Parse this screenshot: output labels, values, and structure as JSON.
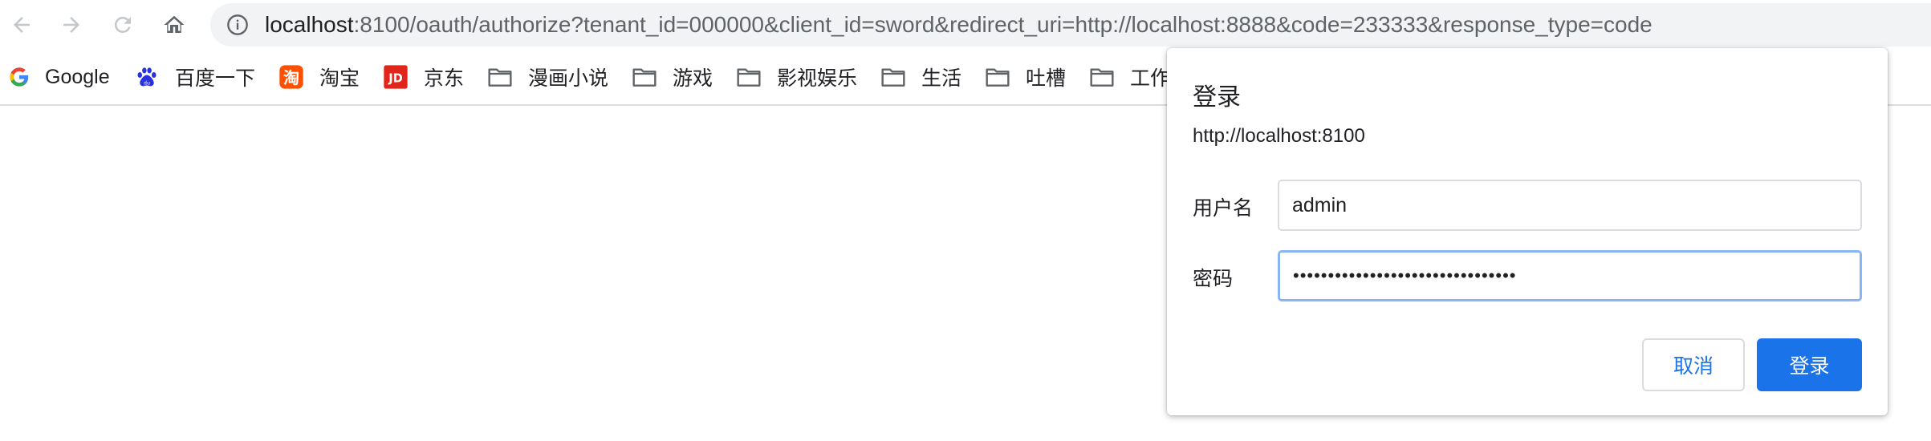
{
  "toolbar": {
    "back_icon": "arrow-left-icon",
    "forward_icon": "arrow-right-icon",
    "reload_icon": "reload-icon",
    "home_icon": "home-icon",
    "info_icon": "info-icon",
    "url_host": "localhost",
    "url_rest": ":8100/oauth/authorize?tenant_id=000000&client_id=sword&redirect_uri=http://localhost:8888&code=233333&response_type=code"
  },
  "bookmarks": [
    {
      "label": "Google",
      "icon": "google-icon"
    },
    {
      "label": "百度一下",
      "icon": "baidu-icon"
    },
    {
      "label": "淘宝",
      "icon": "taobao-icon"
    },
    {
      "label": "京东",
      "icon": "jd-icon"
    },
    {
      "label": "漫画小说",
      "icon": "folder-icon"
    },
    {
      "label": "游戏",
      "icon": "folder-icon"
    },
    {
      "label": "影视娱乐",
      "icon": "folder-icon"
    },
    {
      "label": "生活",
      "icon": "folder-icon"
    },
    {
      "label": "吐槽",
      "icon": "folder-icon"
    },
    {
      "label": "工作",
      "icon": "folder-icon"
    }
  ],
  "dialog": {
    "title": "登录",
    "origin": "http://localhost:8100",
    "username_label": "用户名",
    "username_value": "admin",
    "password_label": "密码",
    "password_value": "••••••••••••••••••••••••••••••••",
    "cancel_label": "取消",
    "submit_label": "登录"
  },
  "colors": {
    "accent": "#1a73e8",
    "focus_ring": "#8ab4f8",
    "omnibox_bg": "#f1f3f4"
  }
}
